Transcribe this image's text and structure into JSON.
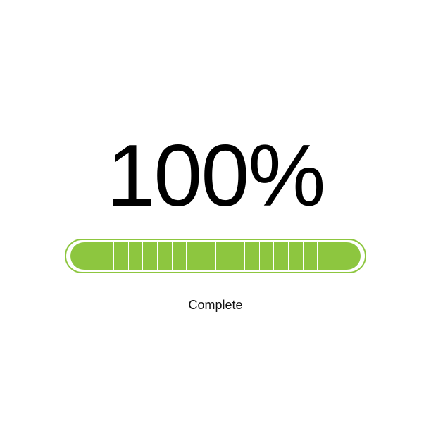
{
  "progress": {
    "percent_label": "100%",
    "value": 1.0,
    "segments": 20,
    "status_label": "Complete",
    "colors": {
      "fill": "#8dc63f",
      "border": "#8dc63f",
      "divider": "#ffffff",
      "text": "#000000"
    }
  }
}
